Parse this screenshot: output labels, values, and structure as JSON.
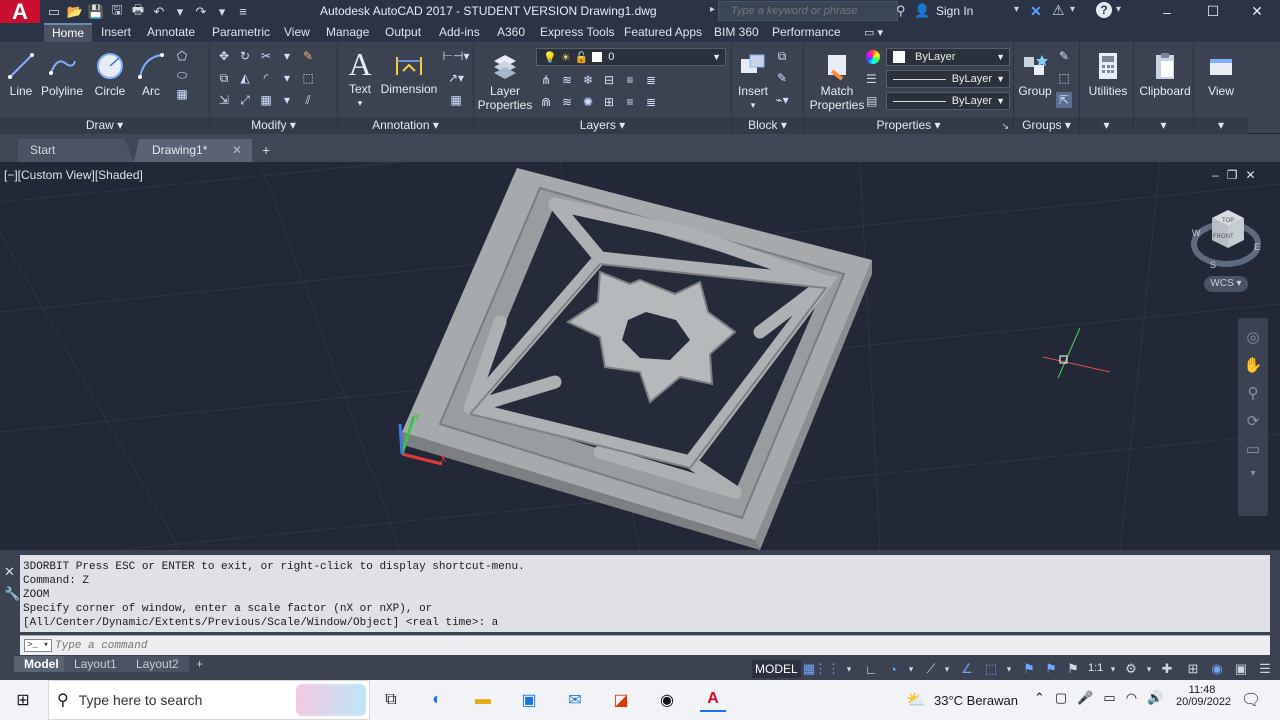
{
  "title_bar": {
    "app_logo": "A",
    "title": "Autodesk AutoCAD 2017 - STUDENT VERSION    Drawing1.dwg",
    "search_placeholder": "Type a keyword or phrase",
    "sign_in": "Sign In",
    "minimize": "–",
    "maximize": "☐",
    "close": "✕"
  },
  "ribbon_tabs": [
    "Home",
    "Insert",
    "Annotate",
    "Parametric",
    "View",
    "Manage",
    "Output",
    "Add-ins",
    "A360",
    "Express Tools",
    "Featured Apps",
    "BIM 360",
    "Performance"
  ],
  "ribbon": {
    "draw": {
      "label": "Draw",
      "tools": [
        "Line",
        "Polyline",
        "Circle",
        "Arc"
      ]
    },
    "modify": {
      "label": "Modify"
    },
    "annotation": {
      "label": "Annotation",
      "tools": [
        "Text",
        "Dimension"
      ]
    },
    "layers": {
      "label": "Layers",
      "tool": "Layer Properties",
      "layer_name": "0"
    },
    "block": {
      "label": "Block",
      "tool": "Insert"
    },
    "properties": {
      "label": "Properties",
      "tool": "Match Properties",
      "color": "ByLayer",
      "linetype": "ByLayer",
      "lineweight": "ByLayer"
    },
    "groups": {
      "label": "Groups",
      "tool": "Group"
    },
    "utilities": "Utilities",
    "clipboard": "Clipboard",
    "view": "View"
  },
  "doc_tabs": {
    "start": "Start",
    "drawing": "Drawing1*",
    "add": "+"
  },
  "viewport": {
    "label": "[−][Custom View][Shaded]",
    "viewcube_top": "TOP",
    "viewcube_front": "FRONT",
    "compass": {
      "w": "W",
      "e": "E",
      "s": "S"
    },
    "wcs": "WCS",
    "ucs_y": "Y",
    "ucs_x": "X"
  },
  "command": {
    "history": [
      "3DORBIT Press ESC or ENTER to exit, or right-click to display shortcut-menu.",
      "Command: Z",
      "ZOOM",
      "Specify corner of window, enter a scale factor (nX or nXP), or",
      "[All/Center/Dynamic/Extents/Previous/Scale/Window/Object] <real time>: a"
    ],
    "placeholder": "Type a command",
    "prompt": ">_"
  },
  "status_bar": {
    "layout_tabs": [
      "Model",
      "Layout1",
      "Layout2"
    ],
    "add": "+",
    "model": "MODEL",
    "scale": "1:1"
  },
  "taskbar": {
    "search_placeholder": "Type here to search",
    "weather": "33°C  Berawan",
    "time": "11:48",
    "date": "20/09/2022"
  },
  "colors": {
    "autocad_red": "#c8102e",
    "background": "#222837",
    "solid": "#9a9d9f"
  }
}
